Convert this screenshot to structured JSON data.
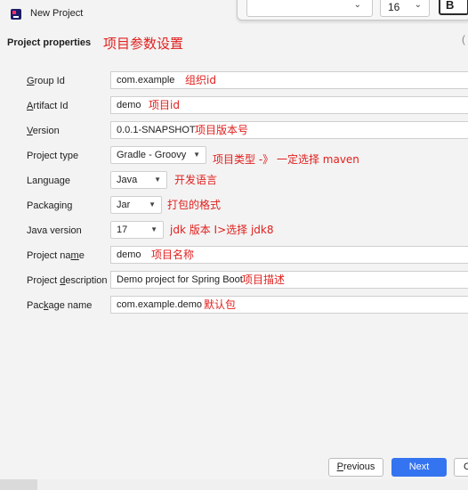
{
  "window": {
    "title": "New Project"
  },
  "toolbar_overlay": {
    "font_size": "16",
    "bold_label": "B",
    "chevron": "⌄"
  },
  "right_edge_char": "(",
  "section": {
    "title": "Project properties",
    "annotation": "项目参数设置"
  },
  "rows": {
    "group_id": {
      "label_pre": "",
      "mnemonic": "G",
      "label_post": "roup Id",
      "value": "com.example",
      "annotation": "组织id"
    },
    "artifact_id": {
      "label_pre": "",
      "mnemonic": "A",
      "label_post": "rtifact Id",
      "value": "demo",
      "annotation": "项目id"
    },
    "version": {
      "label_pre": "",
      "mnemonic": "V",
      "label_post": "ersion",
      "value": "0.0.1-SNAPSHOT",
      "annotation": "项目版本号"
    },
    "project_type": {
      "label": "Project type",
      "value": "Gradle - Groovy",
      "annotation": "项目类型 -》 一定选择 maven"
    },
    "language": {
      "label": "Language",
      "value": "Java",
      "annotation": "开发语言"
    },
    "packaging": {
      "label": "Packaging",
      "value": "Jar",
      "annotation": "打包的格式"
    },
    "java_version": {
      "label": "Java version",
      "value": "17",
      "annotation": "jdk 版本 I>选择 jdk8"
    },
    "project_name": {
      "label_pre": "Project na",
      "mnemonic": "m",
      "label_post": "e",
      "value": "demo",
      "annotation": "项目名称"
    },
    "project_description": {
      "label_pre": "Project ",
      "mnemonic": "d",
      "label_post": "escription",
      "value": "Demo project for Spring Boot",
      "annotation": "项目描述"
    },
    "package_name": {
      "label_pre": "Pac",
      "mnemonic": "k",
      "label_post": "age name",
      "value": "com.example.demo",
      "annotation": "默认包"
    }
  },
  "buttons": {
    "previous": {
      "mnemonic": "P",
      "label_post": "revious"
    },
    "next": "Next",
    "cancel_partial": "C"
  },
  "colors": {
    "annotation": "#e0201e",
    "primary": "#3574f0",
    "background": "#f3f3f3"
  },
  "icons": {
    "app": "intellij-idea-icon",
    "dropdown": "chevron-down-icon"
  }
}
